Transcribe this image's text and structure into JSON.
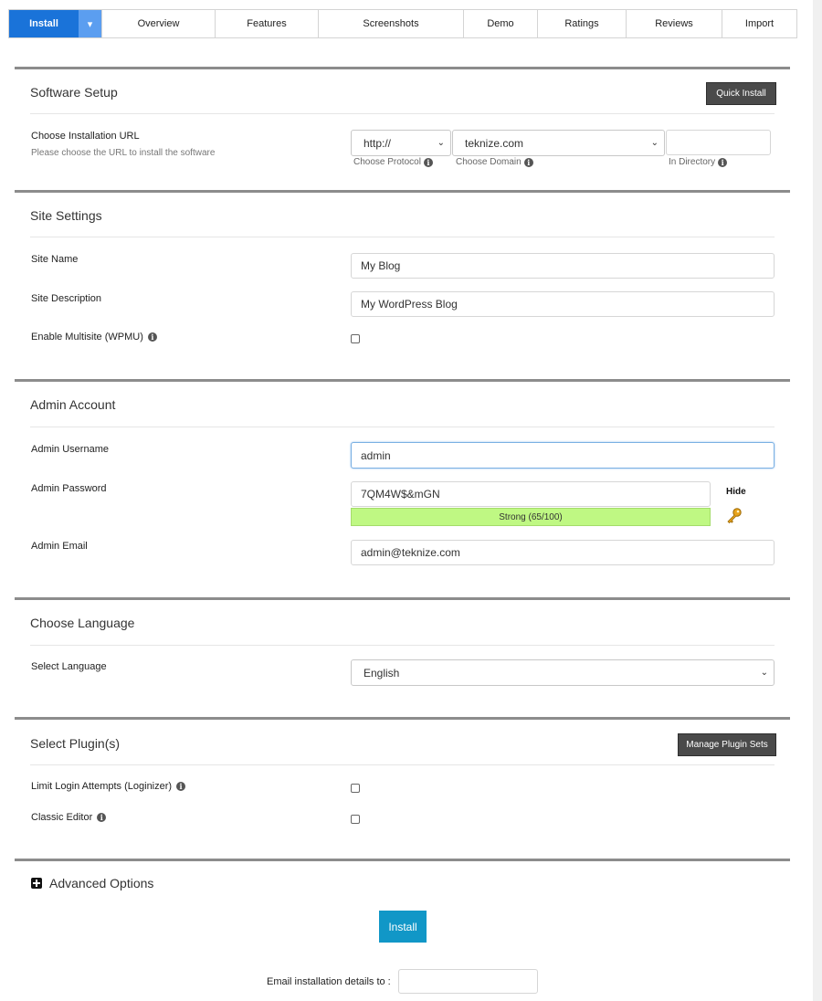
{
  "tabs": {
    "install": "Install",
    "dropdown_icon": "caret-down",
    "items": [
      "Overview",
      "Features",
      "Screenshots",
      "Demo",
      "Ratings",
      "Reviews",
      "Import"
    ]
  },
  "software_setup": {
    "title": "Software Setup",
    "quick_install": "Quick Install",
    "url_label": "Choose Installation URL",
    "url_sub": "Please choose the URL to install the software",
    "protocol_value": "http://",
    "protocol_hint": "Choose Protocol",
    "domain_value": "teknize.com",
    "domain_hint": "Choose Domain",
    "directory_value": "",
    "directory_hint": "In Directory"
  },
  "site_settings": {
    "title": "Site Settings",
    "site_name_label": "Site Name",
    "site_name_value": "My Blog",
    "site_desc_label": "Site Description",
    "site_desc_value": "My WordPress Blog",
    "multisite_label": "Enable Multisite (WPMU)"
  },
  "admin_account": {
    "title": "Admin Account",
    "username_label": "Admin Username",
    "username_value": "admin",
    "password_label": "Admin Password",
    "password_value": "7QM4W$&mGN",
    "strength_text": "Strong (65/100)",
    "hide_label": "Hide",
    "key_icon": "key-icon",
    "email_label": "Admin Email",
    "email_value": "admin@teknize.com"
  },
  "language": {
    "title": "Choose Language",
    "select_label": "Select Language",
    "selected": "English"
  },
  "plugins": {
    "title": "Select Plugin(s)",
    "manage_button": "Manage Plugin Sets",
    "items": [
      "Limit Login Attempts (Loginizer)",
      "Classic Editor"
    ]
  },
  "advanced": {
    "label": "Advanced Options"
  },
  "footer": {
    "install_button": "Install",
    "email_label": "Email installation details to :",
    "email_value": ""
  },
  "colors": {
    "tab_active": "#1a73d9",
    "install_button": "#1197c7",
    "strength_bar": "#bff883"
  }
}
